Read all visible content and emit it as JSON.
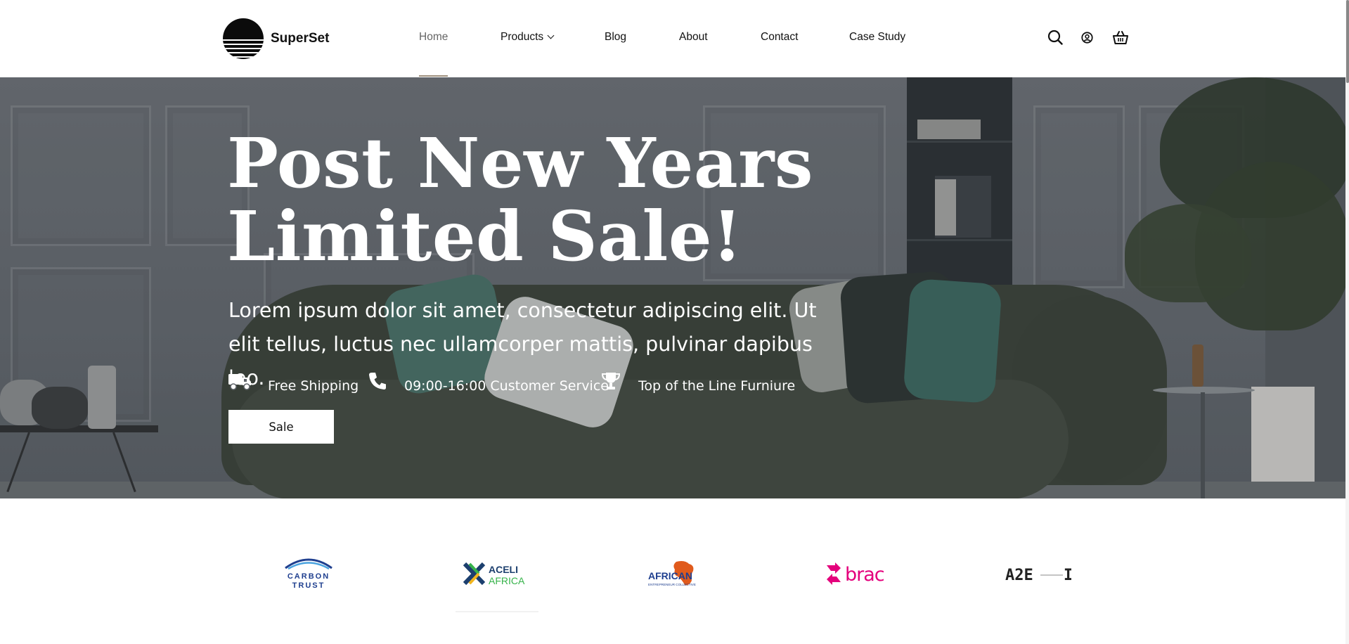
{
  "brand": {
    "name": "SuperSet"
  },
  "nav": {
    "items": [
      {
        "label": "Home",
        "active": true
      },
      {
        "label": "Products",
        "has_dropdown": true
      },
      {
        "label": "Blog"
      },
      {
        "label": "About"
      },
      {
        "label": "Contact"
      },
      {
        "label": "Case Study"
      }
    ]
  },
  "header_icons": [
    "search-icon",
    "account-icon",
    "cart-basket-icon"
  ],
  "hero": {
    "title_line1": "Post New Years",
    "title_line2": "Limited Sale!",
    "subtitle": "Lorem ipsum dolor sit amet, consectetur adipiscing elit. Ut elit tellus, luctus nec ullamcorper mattis, pulvinar dapibus leo.",
    "features": [
      {
        "icon": "truck-icon",
        "label": "Free Shipping"
      },
      {
        "icon": "phone-icon",
        "label": "09:00-16:00 Customer Service"
      },
      {
        "icon": "trophy-icon",
        "label": "Top of the Line Furniure"
      }
    ],
    "cta_label": "Sale"
  },
  "partner_logos": {
    "carbon": {
      "line1": "CARBON",
      "line2": "TRUST"
    },
    "aceli": {
      "line1": "ACELI",
      "line2": "AFRICA"
    },
    "african": {
      "name": "AFRICAN",
      "tagline": "ENTREPRENEUR COLLECTIVE"
    },
    "brac": {
      "name": "brac"
    },
    "a2e": {
      "name": "A2E",
      "suffix": "I"
    }
  },
  "colors": {
    "nav_active_underline": "#9e8f7d",
    "hero_text": "#ffffff",
    "brac_pink": "#e4007c",
    "carbon_blue": "#1f3f8f",
    "aceli_green": "#36b34a",
    "african_orange": "#e05a1c"
  }
}
